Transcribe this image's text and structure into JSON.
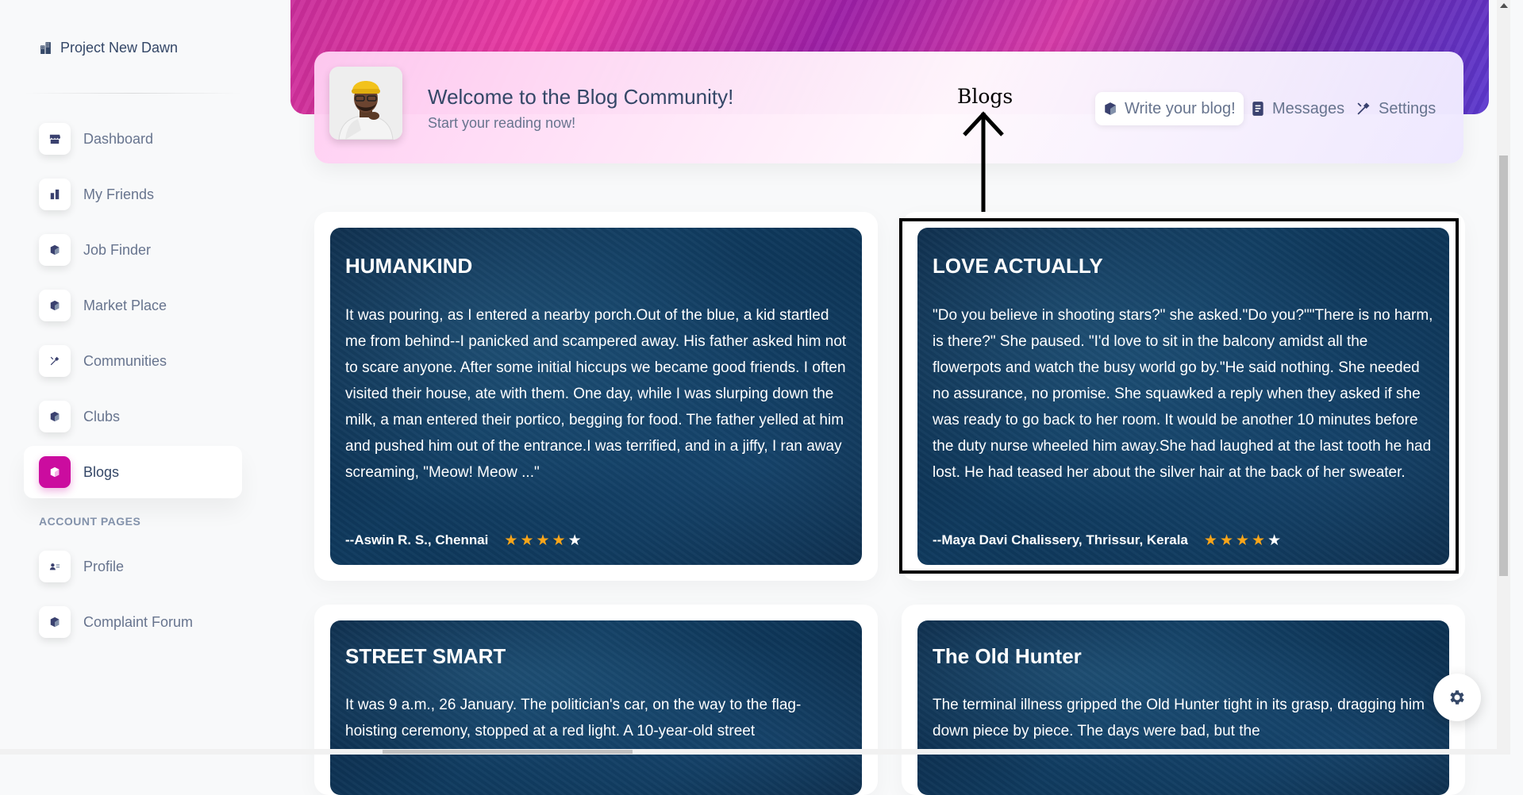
{
  "brand": {
    "name": "Project New Dawn",
    "icon": "building-icon"
  },
  "sidebar": {
    "items": [
      {
        "label": "Dashboard",
        "icon": "shop-icon"
      },
      {
        "label": "My Friends",
        "icon": "building-icon"
      },
      {
        "label": "Job Finder",
        "icon": "cube-icon"
      },
      {
        "label": "Market Place",
        "icon": "cube-icon"
      },
      {
        "label": "Communities",
        "icon": "tools-icon"
      },
      {
        "label": "Clubs",
        "icon": "cube-icon"
      },
      {
        "label": "Blogs",
        "icon": "cube-icon",
        "active": true
      }
    ],
    "section_label": "ACCOUNT PAGES",
    "account_items": [
      {
        "label": "Profile",
        "icon": "user-card-icon"
      },
      {
        "label": "Complaint Forum",
        "icon": "cube-icon"
      }
    ]
  },
  "header": {
    "title": "Welcome to the Blog Community!",
    "subtitle": "Start your reading now!",
    "actions": [
      {
        "label": "Write your blog!",
        "icon": "cube-icon"
      },
      {
        "label": "Messages",
        "icon": "document-icon"
      },
      {
        "label": "Settings",
        "icon": "tools-icon"
      }
    ]
  },
  "annotation": {
    "label": "Blogs"
  },
  "blogs": [
    {
      "title": "HUMANKIND",
      "text": "It was pouring, as I entered a nearby porch.Out of the blue, a kid startled me from behind--I panicked and scampered away. His father asked him not to scare anyone. After some initial hiccups we became good friends. I often visited their house, ate with them. One day, while I was slurping down the milk, a man entered their portico, begging for food. The father yelled at him and pushed him out of the entrance.I was terrified, and in a jiffy, I ran away screaming, \"Meow! Meow ...\"",
      "author": "--Aswin R. S., Chennai",
      "rating": 4,
      "rating_max": 5
    },
    {
      "title": "LOVE ACTUALLY",
      "text": "\"Do you believe in shooting stars?\" she asked.\"Do you?\"\"There is no harm, is there?\" She paused. \"I'd love to sit in the balcony amidst all the flowerpots and watch the busy world go by.\"He said nothing. She needed no assurance, no promise. She squawked a reply when they asked if she was ready to go back to her room. It would be another 10 minutes before the duty nurse wheeled him away.She had laughed at the last tooth he had lost. He had teased her about the silver hair at the back of her sweater.",
      "author": "--Maya Davi Chalissery, Thrissur, Kerala",
      "rating": 4,
      "rating_max": 5
    },
    {
      "title": "STREET SMART",
      "text": "It was 9 a.m., 26 January. The politician's car, on the way to the flag-hoisting ceremony, stopped at a red light. A 10-year-old street"
    },
    {
      "title": "The Old Hunter",
      "text": "The terminal illness gripped the Old Hunter tight in its grasp, dragging him down piece by piece. The days were bad, but the"
    }
  ],
  "colors": {
    "accent": "#cb0c9f",
    "star": "#f9a51a",
    "text": "#344767",
    "muted": "#67748e"
  }
}
